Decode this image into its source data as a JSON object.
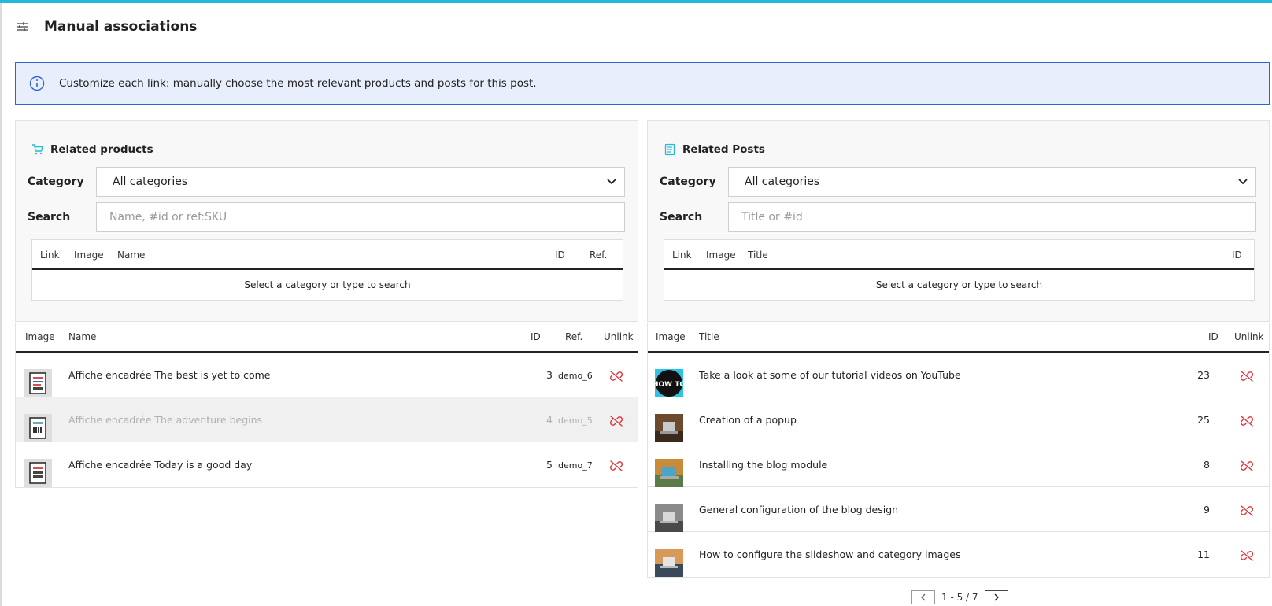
{
  "header": {
    "title": "Manual associations",
    "icon": "sliders-icon"
  },
  "alert": {
    "text": "Customize each link: manually choose the most relevant products and posts for this post.",
    "icon": "info-circle-icon"
  },
  "products": {
    "title": "Related products",
    "icon": "cart-icon",
    "category_label": "Category",
    "category_value": "All categories",
    "search_label": "Search",
    "search_placeholder": "Name, #id or ref:SKU",
    "search_table": {
      "columns": [
        "Link",
        "Image",
        "Name",
        "ID",
        "Ref."
      ],
      "empty": "Select a category or type to search"
    },
    "linked_table": {
      "columns": [
        "Image",
        "Name",
        "ID",
        "Ref.",
        "Unlink"
      ],
      "rows": [
        {
          "name": "Affiche encadrée The best is yet to come",
          "id": "3",
          "ref": "demo_6",
          "disabled": false
        },
        {
          "name": "Affiche encadrée The adventure begins",
          "id": "4",
          "ref": "demo_5",
          "disabled": true
        },
        {
          "name": "Affiche encadrée Today is a good day",
          "id": "5",
          "ref": "demo_7",
          "disabled": false
        }
      ]
    }
  },
  "posts": {
    "title": "Related Posts",
    "icon": "document-icon",
    "category_label": "Category",
    "category_value": "All categories",
    "search_label": "Search",
    "search_placeholder": "Title or #id",
    "search_table": {
      "columns": [
        "Link",
        "Image",
        "Title",
        "ID"
      ],
      "empty": "Select a category or type to search"
    },
    "linked_table": {
      "columns": [
        "Image",
        "Title",
        "ID",
        "Unlink"
      ],
      "rows": [
        {
          "title": "Take a look at some of our tutorial videos on YouTube",
          "id": "23",
          "thumb_text": "HOW TO"
        },
        {
          "title": "Creation of a popup",
          "id": "25"
        },
        {
          "title": "Installing the blog module",
          "id": "8"
        },
        {
          "title": "General configuration of the blog design",
          "id": "9"
        },
        {
          "title": "How to configure the slideshow and category images",
          "id": "11"
        }
      ]
    },
    "pagination": {
      "text": "1 - 5 / 7"
    }
  },
  "colors": {
    "accent": "#25b9d7",
    "info_border": "#2e63d6",
    "info_bg": "#e8eefc",
    "unlink": "#e0313c"
  }
}
